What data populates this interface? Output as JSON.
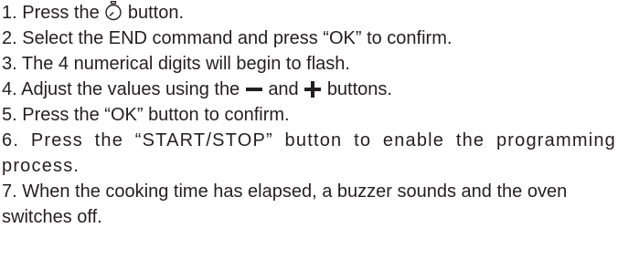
{
  "steps": [
    {
      "number": "1.",
      "before": "Press the",
      "icon": "timer-icon",
      "after": "button."
    },
    {
      "number": "2.",
      "text": "Select the END command and press “OK” to confirm."
    },
    {
      "number": "3.",
      "text": "The 4 numerical digits will begin to flash."
    },
    {
      "number": "4.",
      "before": "Adjust the values using the",
      "icon_minus": "minus-icon",
      "middle": "and",
      "icon_plus": "plus-icon",
      "after": "buttons."
    },
    {
      "number": "5.",
      "text": "Press the “OK” button to confirm."
    },
    {
      "number": "6.",
      "text": "Press the “START/STOP” button to enable the programming process."
    },
    {
      "number": "7.",
      "text": "When the cooking time has elapsed, a buzzer sounds and the oven switches off."
    }
  ],
  "colors": {
    "text": "#231f20"
  }
}
